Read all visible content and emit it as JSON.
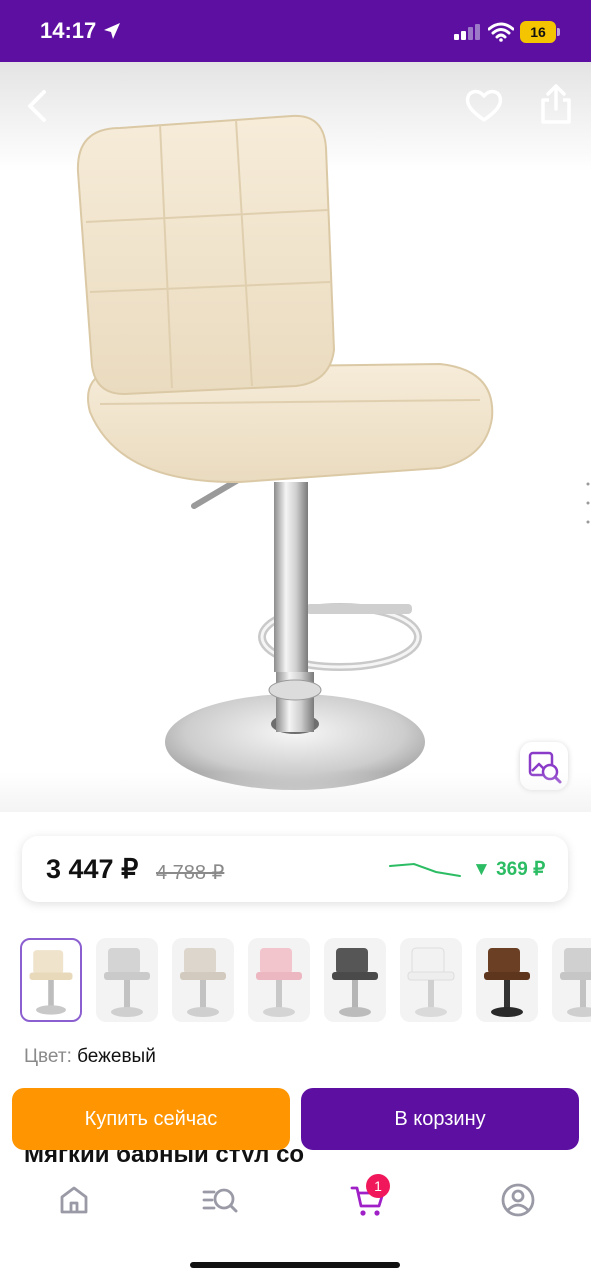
{
  "status_bar": {
    "time": "14:17",
    "battery_level": "16",
    "location_icon": "location-arrow-icon",
    "signal_icon": "cell-signal-icon",
    "wifi_icon": "wifi-icon"
  },
  "gallery": {
    "back_icon": "chevron-left-icon",
    "favorite_icon": "heart-icon",
    "share_icon": "share-icon",
    "image_search_icon": "image-search-icon"
  },
  "price": {
    "current": "3 447 ₽",
    "old": "4 788 ₽",
    "drop": "▼ 369 ₽",
    "drop_color": "#2cbc63"
  },
  "swatches": {
    "items": [
      "бежевый",
      "серый",
      "бежевый",
      "розовый",
      "тёмно-серый",
      "белый",
      "коричневый",
      "серый"
    ],
    "selected_index": 0
  },
  "color": {
    "label": "Цвет:",
    "value": "бежевый"
  },
  "actions": {
    "buy_now": "Купить сейчас",
    "add_to_cart": "В корзину"
  },
  "product": {
    "title_partial": "Мягкий барный стул со"
  },
  "bottom_nav": {
    "cart_badge": "1",
    "icons": [
      "home-icon",
      "catalog-search-icon",
      "cart-icon",
      "profile-icon"
    ]
  },
  "colors": {
    "brand": "#5d0fa2",
    "buy": "#ff9500",
    "badge": "#f0185a",
    "nav_icon": "#9a9aa6",
    "nav_active": "#a020c8"
  }
}
